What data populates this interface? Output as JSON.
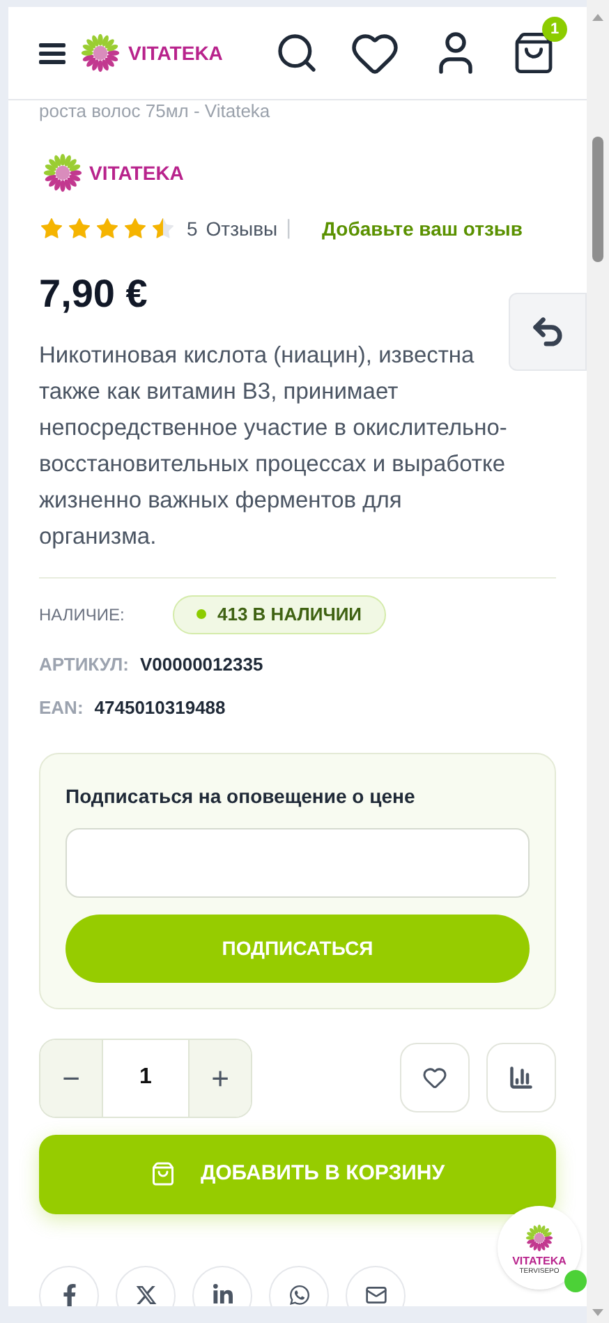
{
  "header": {
    "logo_text": "VITATEKA",
    "cart_count": "1"
  },
  "breadcrumb_title": "роста волос 75мл - Vitateka",
  "brand": {
    "logo_text": "VITATEKA"
  },
  "rating": {
    "stars": 4.5,
    "count": "5",
    "reviews_label": "Отзывы",
    "separator": "|",
    "add_review": "Добавьте ваш отзыв"
  },
  "price": "7,90 €",
  "description": [
    "Никотиновая кислота (ниацин), известна",
    "также как витамин B3, принимает",
    "непосредственное участие в окислительно-",
    "восстановительных процессах и выработке",
    "жизненно важных ферментов для",
    "организма."
  ],
  "details": [
    {
      "kind": "stock",
      "label": "НАЛИЧИЕ:",
      "value": "413 В НАЛИЧИИ",
      "color": "#8ccc00"
    },
    {
      "kind": "text",
      "label": "АРТИКУЛ:",
      "value": "V00000012335"
    },
    {
      "kind": "text",
      "label": "EAN:",
      "value": "4745010319488"
    }
  ],
  "price_alert": {
    "title": "Подписаться на оповещение о цене",
    "button": "ПОДПИСАТЬСЯ"
  },
  "quantity": {
    "minus": "−",
    "value": "1",
    "plus": "+"
  },
  "add_to_cart": "ДОБАВИТЬ В КОРЗИНУ",
  "share": [
    {
      "kind": "facebook"
    },
    {
      "kind": "x"
    },
    {
      "kind": "linkedin"
    },
    {
      "kind": "whatsapp"
    },
    {
      "kind": "email"
    }
  ],
  "chat_widget": {
    "logo_text": "VITATEKA",
    "subtitle": "TERVISEPO",
    "online": true
  }
}
